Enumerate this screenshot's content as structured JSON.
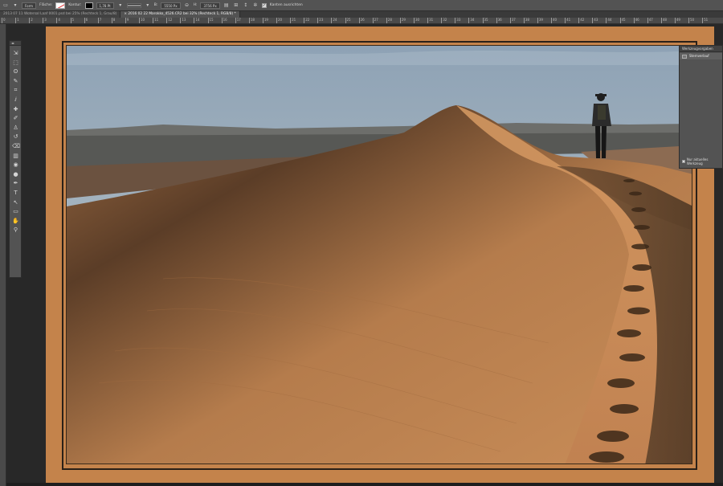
{
  "options_bar": {
    "tool_icon": "rectangle-tool-icon",
    "mode_value": "Form",
    "fill_label": "Fläche:",
    "stroke_label": "Kontur:",
    "stroke_width": "1,78 Pt",
    "width_label": "B:",
    "width_value": "5550 Px",
    "link_icon": "link-icon",
    "height_label": "H:",
    "height_value": "3756 Px",
    "align_edges_label": "Kanten ausrichten"
  },
  "tabs": [
    {
      "label": "2013 07 11 Wotersal Laaf 0001.psd bei 25% (Rechteck 1, Grau/8)",
      "active": false
    },
    {
      "label": "2016 02 22 Marokko_4526.CR2 bei 32% (Rechteck 1, RGB/8) *",
      "active": true
    }
  ],
  "ruler_ticks": [
    "0",
    "1",
    "2",
    "3",
    "4",
    "5",
    "6",
    "7",
    "8",
    "9",
    "10",
    "11",
    "12",
    "13",
    "14",
    "15",
    "16",
    "17",
    "18",
    "19",
    "20",
    "21",
    "22",
    "23",
    "24",
    "25",
    "26",
    "27",
    "28",
    "29",
    "30",
    "31",
    "32",
    "33",
    "34",
    "35",
    "36",
    "37",
    "38",
    "39",
    "40",
    "41",
    "42",
    "43",
    "44",
    "45",
    "46",
    "47",
    "48",
    "49",
    "50",
    "51"
  ],
  "toolbox": {
    "collapse_label": "◂▸",
    "tools": [
      "move-tool-icon",
      "marquee-tool-icon",
      "lasso-tool-icon",
      "quick-select-tool-icon",
      "crop-tool-icon",
      "eyedropper-tool-icon",
      "healing-brush-icon",
      "brush-tool-icon",
      "clone-stamp-icon",
      "history-brush-icon",
      "eraser-tool-icon",
      "gradient-tool-icon",
      "blur-tool-icon",
      "dodge-tool-icon",
      "pen-tool-icon",
      "type-tool-icon",
      "path-select-icon",
      "rectangle-tool-icon",
      "hand-tool-icon",
      "zoom-tool-icon"
    ]
  },
  "panel": {
    "title": "Werkzeugvorgaben",
    "item_label": "Sternverlauf",
    "footer_label": "Nur aktuelles Werkzeug"
  },
  "colors": {
    "document_bg": "#c4834b",
    "sky_top": "#8fa3b6",
    "sand": "#c88a55",
    "ui_dark": "#282828",
    "ui_mid": "#535353"
  }
}
